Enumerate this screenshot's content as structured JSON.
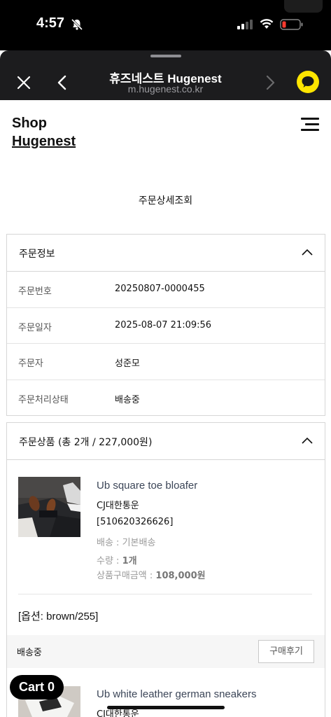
{
  "status_bar": {
    "time": "4:57",
    "faded_text": ""
  },
  "browser": {
    "title": "휴즈네스트 Hugenest",
    "url": "m.hugenest.co.kr"
  },
  "shop": {
    "logo_line1": "Shop",
    "logo_line2": "Hugenest"
  },
  "page_title": "주문상세조회",
  "order_info": {
    "heading": "주문정보",
    "rows": [
      {
        "label": "주문번호",
        "value": "20250807-0000455"
      },
      {
        "label": "주문일자",
        "value": "2025-08-07 21:09:56"
      },
      {
        "label": "주문자",
        "value": "성준모"
      },
      {
        "label": "주문처리상태",
        "value": "배송중"
      }
    ]
  },
  "order_items": {
    "heading": "주문상품 (총 2개 / 227,000원)",
    "items": [
      {
        "name": "Ub square toe bloafer",
        "carrier": "CJ대한통운",
        "tracking": "[510620326626]",
        "shipping": "배송 : 기본배송",
        "qty_label": "수량 : ",
        "qty_value": "1개",
        "price_label": "상품구매금액 : ",
        "price_value": "108,000원",
        "option": "[옵션: brown/255]",
        "status": "배송중",
        "review_button": "구매후기"
      },
      {
        "name": "Ub white leather german sneakers",
        "carrier": "CJ대한통운"
      }
    ]
  },
  "cart": {
    "label": "Cart 0"
  },
  "colors": {
    "accent_kakao": "#fee500",
    "browser_bar": "#1c1c1e",
    "product_title": "#3c4658"
  },
  "icons": [
    "bell-off-icon",
    "signal-icon",
    "wifi-icon",
    "battery-icon",
    "close-icon",
    "back-icon",
    "forward-icon",
    "kakao-chat-icon",
    "hamburger-menu-icon",
    "chevron-up-icon"
  ]
}
